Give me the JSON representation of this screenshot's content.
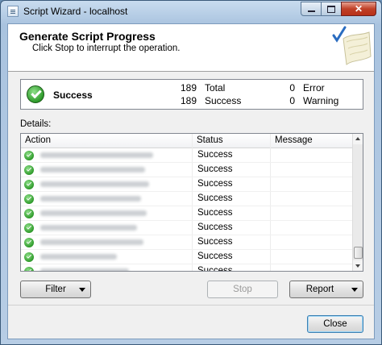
{
  "window": {
    "title": "Script Wizard - localhost",
    "close_glyph": "✕"
  },
  "header": {
    "title": "Generate Script Progress",
    "subtitle": "Click Stop to interrupt the operation."
  },
  "summary": {
    "status": "Success",
    "total_count": "189",
    "total_label": "Total",
    "success_count": "189",
    "success_label": "Success",
    "error_count": "0",
    "error_label": "Error",
    "warning_count": "0",
    "warning_label": "Warning"
  },
  "details_label": "Details:",
  "grid": {
    "columns": [
      "Action",
      "Status",
      "Message"
    ],
    "rows": [
      {
        "status": "Success",
        "icon": "success-check-icon"
      },
      {
        "status": "Success",
        "icon": "success-check-icon"
      },
      {
        "status": "Success",
        "icon": "success-check-icon"
      },
      {
        "status": "Success",
        "icon": "success-check-icon"
      },
      {
        "status": "Success",
        "icon": "success-check-icon"
      },
      {
        "status": "Success",
        "icon": "success-check-icon"
      },
      {
        "status": "Success",
        "icon": "success-check-icon"
      },
      {
        "status": "Success",
        "icon": "success-check-icon"
      },
      {
        "status": "Success",
        "icon": "success-check-icon"
      }
    ]
  },
  "buttons": {
    "filter": "Filter",
    "stop": "Stop",
    "report": "Report",
    "close": "Close"
  },
  "colors": {
    "success_green": "#2e9a2a",
    "title_bar": "#a9c3df",
    "close_button": "#c04028"
  }
}
